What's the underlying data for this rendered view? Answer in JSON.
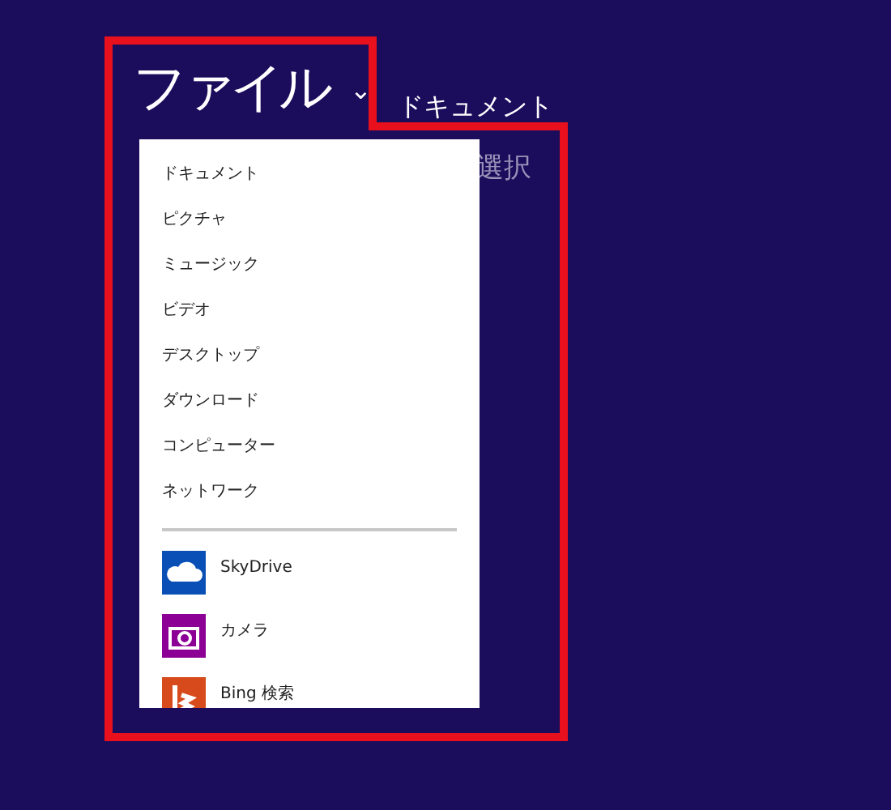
{
  "header": {
    "title": "ファイル",
    "chevron": "⌄",
    "location": "ドキュメント",
    "action": "選択"
  },
  "menu": {
    "places": [
      {
        "label": "ドキュメント"
      },
      {
        "label": "ピクチャ"
      },
      {
        "label": "ミュージック"
      },
      {
        "label": "ビデオ"
      },
      {
        "label": "デスクトップ"
      },
      {
        "label": "ダウンロード"
      },
      {
        "label": "コンピューター"
      },
      {
        "label": "ネットワーク"
      }
    ],
    "apps": [
      {
        "label": "SkyDrive",
        "kind": "cloud",
        "color": "#0a4fb5"
      },
      {
        "label": "カメラ",
        "kind": "camera",
        "color": "#8c0095"
      },
      {
        "label": "Bing 検索",
        "kind": "bing",
        "color": "#d64a1b"
      }
    ]
  }
}
